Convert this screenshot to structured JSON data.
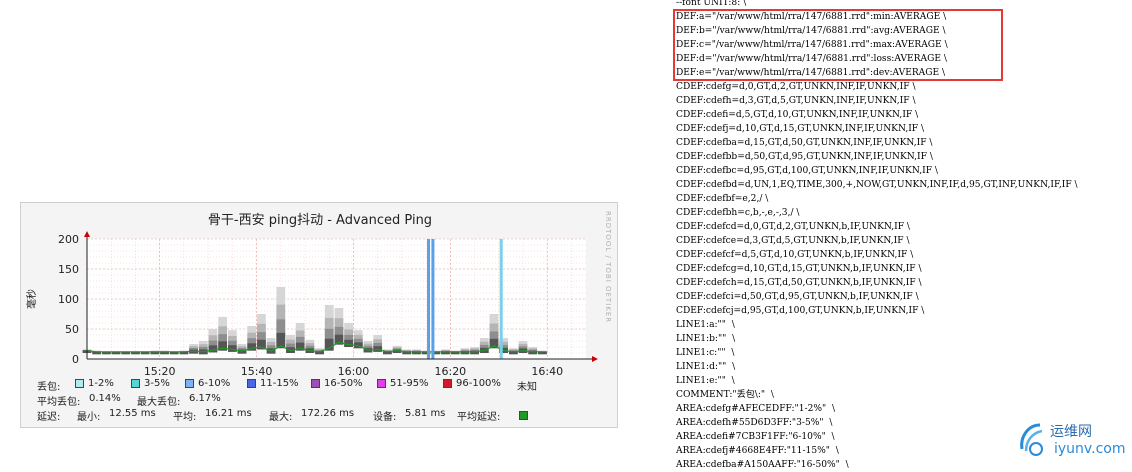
{
  "chart_data": {
    "type": "area",
    "title": "骨干-西安 ping抖动 - Advanced Ping",
    "ylabel": "毫秒",
    "watermark": "RRDTOOL / TOBI OETIKER",
    "ylim": [
      0,
      200
    ],
    "yticks": [
      "0",
      "50",
      "100",
      "150",
      "200"
    ],
    "xticks": [
      "15:20",
      "15:40",
      "16:00",
      "16:20",
      "16:40"
    ],
    "xlim_minutes": [
      0,
      95
    ],
    "xtick_minutes": [
      15,
      35,
      55,
      75,
      95
    ],
    "colors": {
      "latency_line": "#1e9a2a",
      "loss_bar_1": "#5aa0e8",
      "loss_bar_2": "#7ad0ea"
    },
    "series": [
      {
        "name": "latency",
        "x_minutes": [
          0,
          2,
          4,
          6,
          8,
          10,
          12,
          14,
          16,
          18,
          20,
          22,
          24,
          26,
          28,
          30,
          32,
          34,
          36,
          38,
          40,
          42,
          44,
          46,
          48,
          50,
          52,
          54,
          56,
          58,
          60,
          62,
          64,
          66,
          68,
          70,
          72,
          74,
          76,
          78,
          80,
          82,
          84,
          86,
          88,
          90,
          92,
          94
        ],
        "avg": [
          14,
          12,
          12,
          12,
          12,
          12,
          12,
          12,
          12,
          12,
          12,
          13,
          12,
          15,
          18,
          16,
          13,
          18,
          20,
          13,
          22,
          14,
          18,
          14,
          12,
          18,
          28,
          24,
          22,
          15,
          16,
          12,
          14,
          12,
          12,
          12,
          12,
          12,
          12,
          12,
          12,
          14,
          22,
          14,
          12,
          14,
          12,
          12
        ],
        "max": [
          16,
          14,
          13,
          13,
          13,
          13,
          13,
          14,
          14,
          13,
          14,
          25,
          30,
          50,
          70,
          48,
          25,
          55,
          75,
          35,
          120,
          40,
          60,
          32,
          18,
          90,
          85,
          60,
          48,
          30,
          40,
          16,
          22,
          16,
          16,
          14,
          14,
          16,
          14,
          18,
          20,
          35,
          75,
          35,
          18,
          30,
          20,
          14
        ]
      }
    ],
    "loss_markers_minutes": [
      70.5,
      71.4,
      85.5
    ],
    "legend": {
      "loss_label": "丢包:",
      "loss_items": [
        {
          "label": "1-2%",
          "color": "#AFECEDFF"
        },
        {
          "label": "3-5%",
          "color": "#55D6D3FF"
        },
        {
          "label": "6-10%",
          "color": "#7CB3F1FF"
        },
        {
          "label": "11-15%",
          "color": "#4668E4FF"
        },
        {
          "label": "16-50%",
          "color": "#9F4FB3"
        },
        {
          "label": "51-95%",
          "color": "#E040E8"
        },
        {
          "label": "96-100%",
          "color": "#D11A2A"
        }
      ],
      "unknown_label": "未知",
      "avg_loss_label": "平均丢包:",
      "avg_loss_value": "0.14%",
      "max_loss_label": "最大丢包:",
      "max_loss_value": "6.17%",
      "latency_label": "延迟:",
      "min_label": "最小:",
      "min_value": "12.55 ms",
      "avg_label": "平均:",
      "avg_value": "16.21 ms",
      "max_label": "最大:",
      "max_value": "172.26 ms",
      "dev_label": "设备:",
      "dev_value": "5.81 ms",
      "avg_latency_label": "平均延迟:"
    }
  },
  "code_lines": [
    "--font UNIT:8: \\",
    "DEF:a=\"/var/www/html/rra/147/6881.rrd\":min:AVERAGE \\",
    "DEF:b=\"/var/www/html/rra/147/6881.rrd\":avg:AVERAGE \\",
    "DEF:c=\"/var/www/html/rra/147/6881.rrd\":max:AVERAGE \\",
    "DEF:d=\"/var/www/html/rra/147/6881.rrd\":loss:AVERAGE \\",
    "DEF:e=\"/var/www/html/rra/147/6881.rrd\":dev:AVERAGE \\",
    "CDEF:cdefg=d,0,GT,d,2,GT,UNKN,INF,IF,UNKN,IF \\",
    "CDEF:cdefh=d,3,GT,d,5,GT,UNKN,INF,IF,UNKN,IF \\",
    "CDEF:cdefi=d,5,GT,d,10,GT,UNKN,INF,IF,UNKN,IF \\",
    "CDEF:cdefj=d,10,GT,d,15,GT,UNKN,INF,IF,UNKN,IF \\",
    "CDEF:cdefba=d,15,GT,d,50,GT,UNKN,INF,IF,UNKN,IF \\",
    "CDEF:cdefbb=d,50,GT,d,95,GT,UNKN,INF,IF,UNKN,IF \\",
    "CDEF:cdefbc=d,95,GT,d,100,GT,UNKN,INF,IF,UNKN,IF \\",
    "CDEF:cdefbd=d,UN,1,EQ,TIME,300,+,NOW,GT,UNKN,INF,IF,d,95,GT,INF,UNKN,IF,IF \\",
    "CDEF:cdefbf=e,2,/ \\",
    "CDEF:cdefbh=c,b,-,e,-,3,/ \\",
    "CDEF:cdefcd=d,0,GT,d,2,GT,UNKN,b,IF,UNKN,IF \\",
    "CDEF:cdefce=d,3,GT,d,5,GT,UNKN,b,IF,UNKN,IF \\",
    "CDEF:cdefcf=d,5,GT,d,10,GT,UNKN,b,IF,UNKN,IF \\",
    "CDEF:cdefcg=d,10,GT,d,15,GT,UNKN,b,IF,UNKN,IF \\",
    "CDEF:cdefch=d,15,GT,d,50,GT,UNKN,b,IF,UNKN,IF \\",
    "CDEF:cdefci=d,50,GT,d,95,GT,UNKN,b,IF,UNKN,IF \\",
    "CDEF:cdefcj=d,95,GT,d,100,GT,UNKN,b,IF,UNKN,IF \\",
    "LINE1:a:\"\"  \\",
    "LINE1:b:\"\"  \\",
    "LINE1:c:\"\"  \\",
    "LINE1:d:\"\"  \\",
    "LINE1:e:\"\"  \\",
    "COMMENT:\"丢包\\:\"  \\",
    "AREA:cdefg#AFECEDFF:\"1-2%\"  \\",
    "AREA:cdefh#55D6D3FF:\"3-5%\"  \\",
    "AREA:cdefi#7CB3F1FF:\"6-10%\"  \\",
    "AREA:cdefj#4668E4FF:\"11-15%\"  \\",
    "AREA:cdefba#A150AAFF:\"16-50%\"  \\"
  ],
  "site_watermark": {
    "title": "运维网",
    "url": "iyunv.com"
  }
}
